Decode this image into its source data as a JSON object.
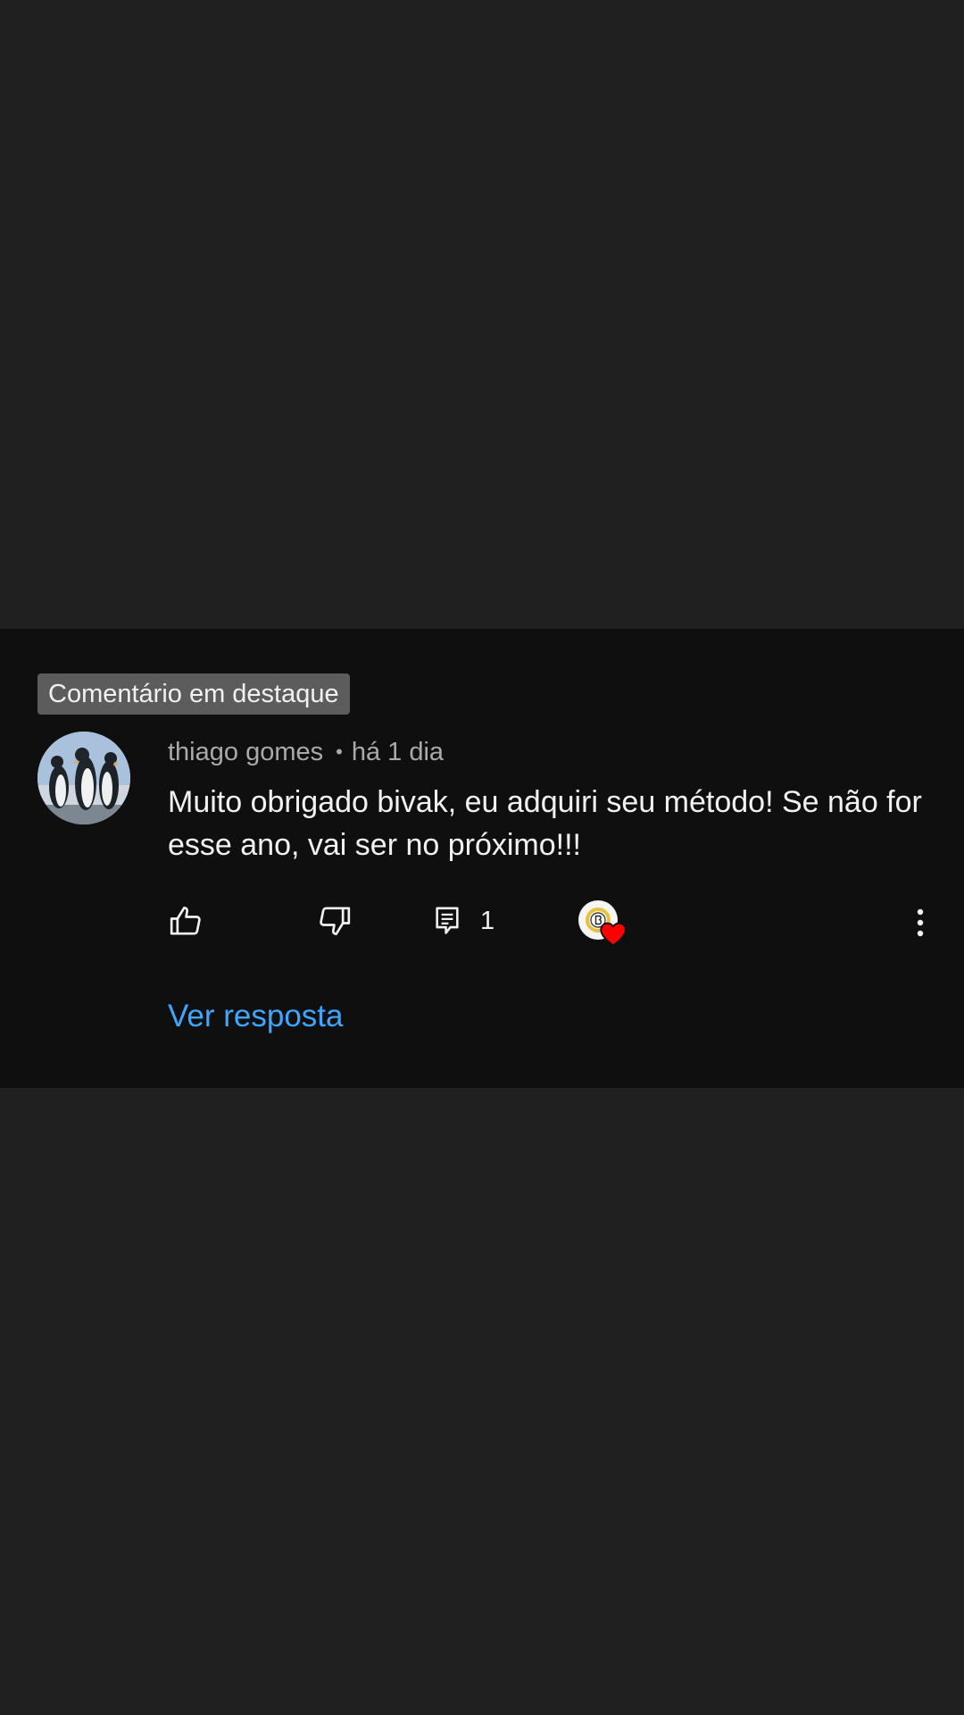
{
  "comment": {
    "badge": "Comentário em destaque",
    "author": "thiago gomes",
    "separator": "•",
    "time": "há 1 dia",
    "text": "Muito obrigado bivak, eu adquiri seu método! Se não for esse ano, vai ser no próximo!!!",
    "reply_count": "1",
    "view_replies_label": "Ver resposta",
    "icons": {
      "avatar": "penguins-avatar",
      "like": "thumbs-up-icon",
      "dislike": "thumbs-down-icon",
      "reply": "reply-comment-icon",
      "creator_heart": "creator-heart-icon",
      "more": "more-vertical-icon"
    }
  },
  "colors": {
    "page_background": "#202020",
    "card_background": "#0f0f0f",
    "badge_background": "#5c5c5c",
    "link": "#3ea6ff",
    "heart": "#ff0000"
  }
}
